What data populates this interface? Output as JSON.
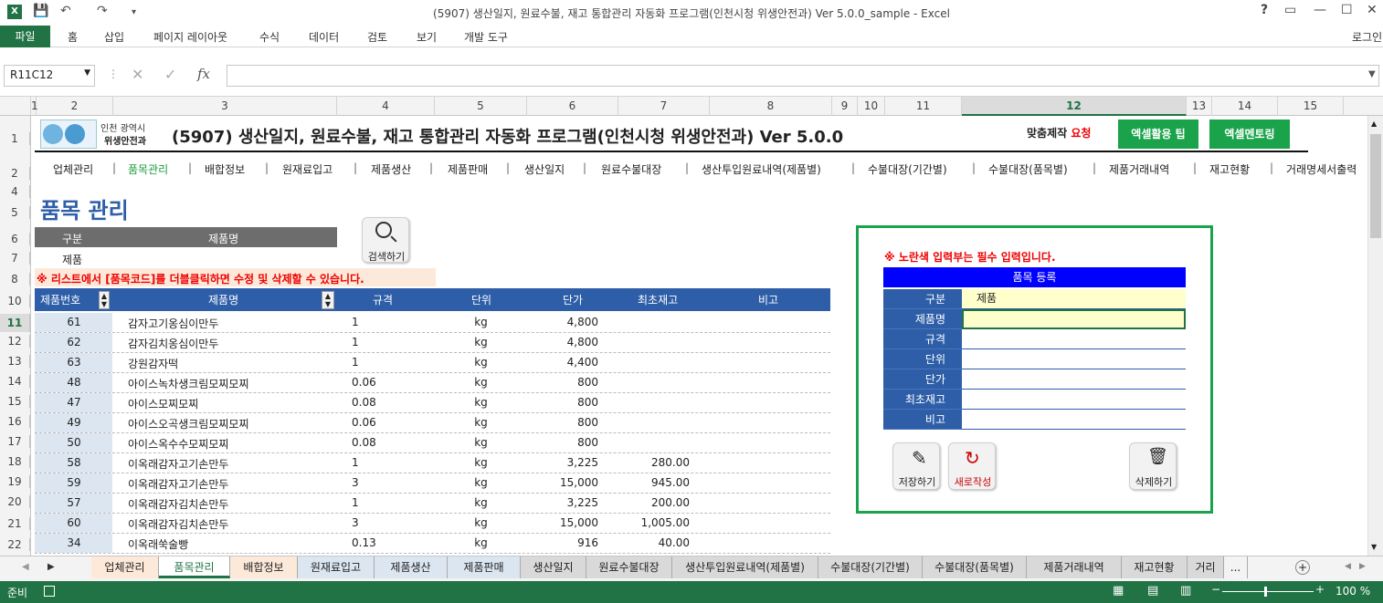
{
  "window": {
    "title": "(5907) 생산일지, 원료수불, 재고 통합관리 자동화 프로그램(인천시청 위생안전과) Ver 5.0.0_sample - Excel",
    "help": "?",
    "login": "로그인"
  },
  "ribbon": {
    "tabs": [
      "파일",
      "홈",
      "삽입",
      "페이지 레이아웃",
      "수식",
      "데이터",
      "검토",
      "보기",
      "개발 도구"
    ]
  },
  "formula_bar": {
    "name_box": "R11C12",
    "fx": "fx",
    "value": ""
  },
  "columns": [
    "1",
    "2",
    "3",
    "4",
    "5",
    "6",
    "7",
    "8",
    "9",
    "10",
    "11",
    "12",
    "13",
    "14",
    "15"
  ],
  "rows": [
    "1",
    "2",
    "4",
    "5",
    "6",
    "7",
    "8",
    "10",
    "11",
    "12",
    "13",
    "14",
    "15",
    "16",
    "17",
    "18",
    "19",
    "20",
    "21",
    "22"
  ],
  "header": {
    "logo_line1": "인천 광역시",
    "logo_line2": "위생안전과",
    "title": "(5907) 생산일지, 원료수불, 재고 통합관리 자동화 프로그램(인천시청 위생안전과) Ver 5.0.0",
    "custom_label": "맞춤제작",
    "custom_request": "요청",
    "btn_tips": "엑셀활용 팁",
    "btn_mentoring": "엑셀멘토링"
  },
  "nav": [
    "업체관리",
    "품목관리",
    "배합정보",
    "원재료입고",
    "제품생산",
    "제품판매",
    "생산일지",
    "원료수불대장",
    "생산투입원료내역(제품별)",
    "수불대장(기간별)",
    "수불대장(품목별)",
    "제품거래내역",
    "재고현황",
    "거래명세서출력"
  ],
  "page_title": "품목 관리",
  "filter": {
    "col1": "구분",
    "col2": "제품명",
    "value1": "제품",
    "value2": "",
    "search_button": "검색하기"
  },
  "notice": "※ 리스트에서 [품목코드]를 더블클릭하면 수정 및 삭제할 수 있습니다.",
  "table": {
    "headers": [
      "제품번호",
      "제품명",
      "규격",
      "단위",
      "단가",
      "최초재고",
      "비고"
    ],
    "rows": [
      [
        "61",
        "감자고기옹심이만두",
        "1",
        "kg",
        "4,800",
        "",
        ""
      ],
      [
        "62",
        "감자김치옹심이만두",
        "1",
        "kg",
        "4,800",
        "",
        ""
      ],
      [
        "63",
        "강원감자떡",
        "1",
        "kg",
        "4,400",
        "",
        ""
      ],
      [
        "48",
        "아이스녹차생크림모찌모찌",
        "0.06",
        "kg",
        "800",
        "",
        ""
      ],
      [
        "47",
        "아이스모찌모찌",
        "0.08",
        "kg",
        "800",
        "",
        ""
      ],
      [
        "49",
        "아이스오곡생크림모찌모찌",
        "0.06",
        "kg",
        "800",
        "",
        ""
      ],
      [
        "50",
        "아이스옥수수모찌모찌",
        "0.08",
        "kg",
        "800",
        "",
        ""
      ],
      [
        "58",
        "이옥래감자고기손만두",
        "1",
        "kg",
        "3,225",
        "280.00",
        ""
      ],
      [
        "59",
        "이옥래감자고기손만두",
        "3",
        "kg",
        "15,000",
        "945.00",
        ""
      ],
      [
        "57",
        "이옥래감자김치손만두",
        "1",
        "kg",
        "3,225",
        "200.00",
        ""
      ],
      [
        "60",
        "이옥래감자김치손만두",
        "3",
        "kg",
        "15,000",
        "1,005.00",
        ""
      ],
      [
        "34",
        "이옥래쑥술빵",
        "0.13",
        "kg",
        "916",
        "40.00",
        ""
      ]
    ]
  },
  "form": {
    "required_note": "※ 노란색 입력부는 필수 입력입니다.",
    "title": "품목 등록",
    "fields": [
      {
        "label": "구분",
        "value": "제품"
      },
      {
        "label": "제품명",
        "value": ""
      },
      {
        "label": "규격",
        "value": ""
      },
      {
        "label": "단위",
        "value": ""
      },
      {
        "label": "단가",
        "value": ""
      },
      {
        "label": "최초재고",
        "value": ""
      },
      {
        "label": "비고",
        "value": ""
      }
    ],
    "save_button": "저장하기",
    "new_button": "새로작성",
    "delete_button": "삭제하기"
  },
  "sheet_tabs": [
    "업체관리",
    "품목관리",
    "배합정보",
    "원재료입고",
    "제품생산",
    "제품판매",
    "생산일지",
    "원료수불대장",
    "생산투입원료내역(제품별)",
    "수불대장(기간별)",
    "수불대장(품목별)",
    "제품거래내역",
    "재고현황",
    "거리",
    "..."
  ],
  "active_sheet": "품목관리",
  "status": {
    "ready": "준비",
    "zoom": "100 %"
  },
  "colors": {
    "excel_green": "#217346",
    "table_header": "#2e5ea8",
    "form_header": "#0000ff",
    "required_yellow": "#ffffcc",
    "form_border": "#1aa34a"
  }
}
